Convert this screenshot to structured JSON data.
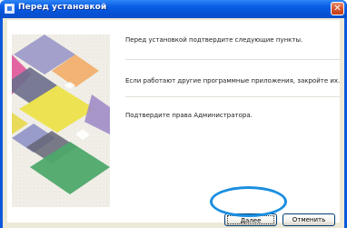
{
  "window": {
    "title": "Перед установкой",
    "close_glyph": "✕"
  },
  "content": {
    "line1": "Перед установкой подтвердите следующие пункты.",
    "line2": "Если работают другие программные приложения, закройте их.",
    "line3": "Подтвердите права Администратора."
  },
  "buttons": {
    "next_label": "Далее",
    "cancel_label": "Отменить"
  },
  "colors": {
    "titlebar": "#0a58dc",
    "highlight_ring": "#1a8ee0"
  }
}
